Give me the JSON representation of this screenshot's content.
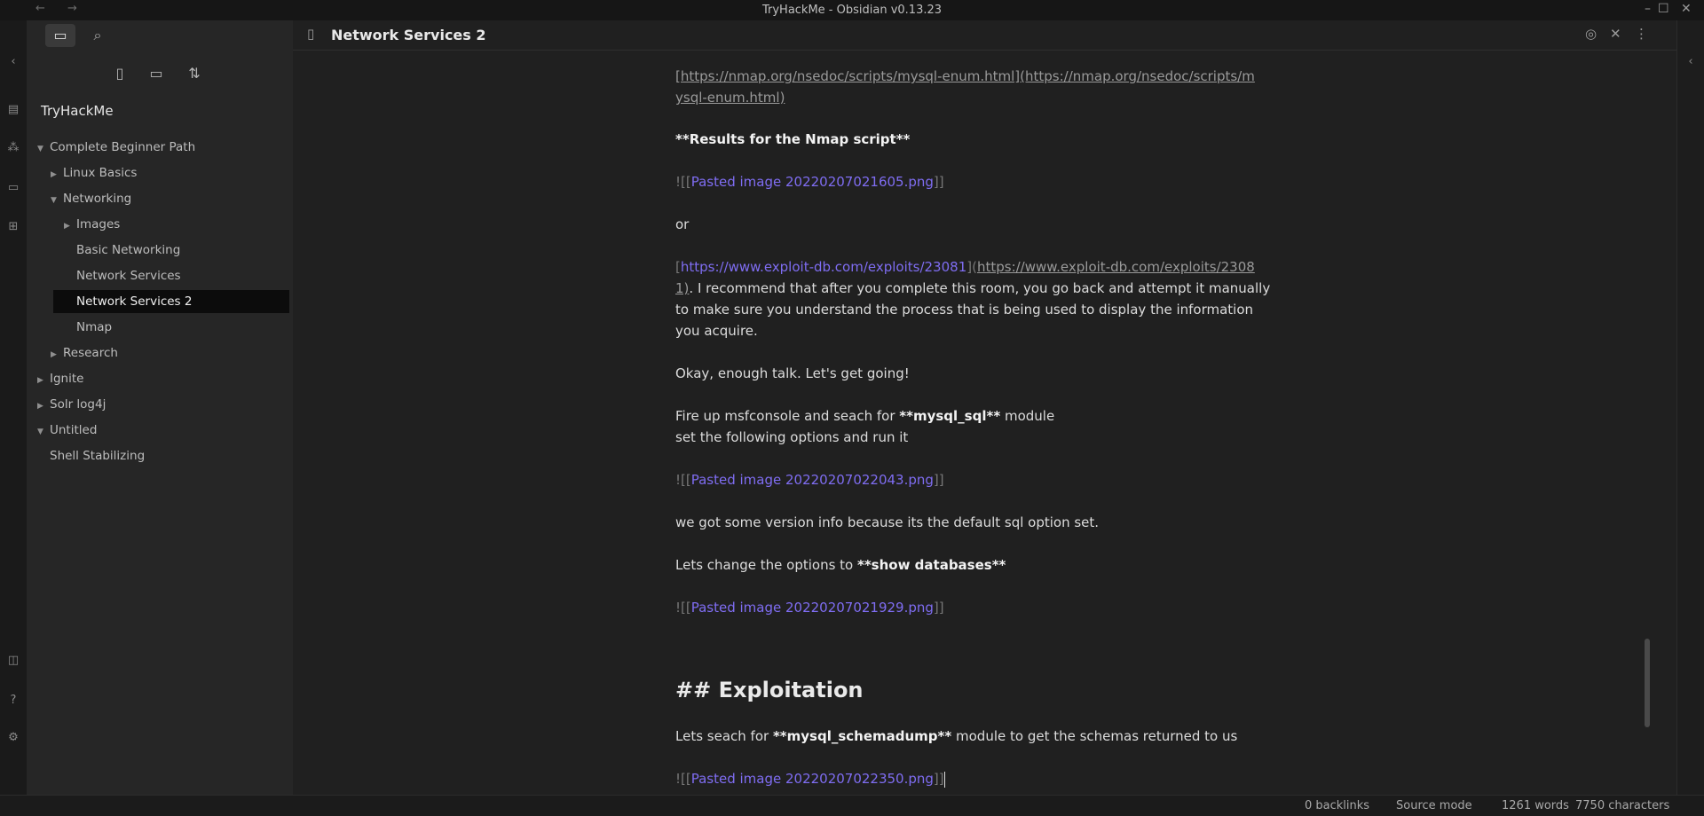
{
  "window": {
    "title": "TryHackMe - Obsidian v0.13.23",
    "nav_back": "←",
    "nav_forward": "→",
    "minimize": "–",
    "maximize": "☐",
    "close": "✕"
  },
  "ribbon": {
    "icons": [
      "collapse-sidebar-icon",
      "switcher-icon",
      "graph-icon",
      "card-icon",
      "plugin-icon",
      "vault-icon",
      "help-icon",
      "settings-icon"
    ]
  },
  "sidebar": {
    "tabs": [
      "folder-icon",
      "search-icon"
    ],
    "actions": [
      "new-note-icon",
      "new-folder-icon",
      "sort-icon"
    ],
    "vault_name": "TryHackMe",
    "tree": [
      {
        "label": "Complete Beginner Path",
        "caret": "▼"
      },
      {
        "label": "Linux Basics",
        "caret": "▶"
      },
      {
        "label": "Networking",
        "caret": "▼"
      },
      {
        "label": "Images",
        "caret": "▶"
      },
      {
        "label": "Basic Networking",
        "caret": ""
      },
      {
        "label": "Network Services",
        "caret": ""
      },
      {
        "label": "Network Services 2",
        "caret": ""
      },
      {
        "label": "Nmap",
        "caret": ""
      },
      {
        "label": "Research",
        "caret": "▶"
      },
      {
        "label": "Ignite",
        "caret": "▶"
      },
      {
        "label": "Solr log4j",
        "caret": "▶"
      },
      {
        "label": "Untitled",
        "caret": "▼"
      },
      {
        "label": "Shell Stabilizing",
        "caret": ""
      }
    ]
  },
  "header": {
    "title": "Network Services 2",
    "icons": [
      "reading-view-icon",
      "close-icon",
      "more-options-icon"
    ]
  },
  "editor": {
    "l_url1_a": "[https://nmap.org/nsedoc/scripts/mysql-enum.html](https://nmap.org/nsedoc/scripts/m",
    "l_url1_b": "ysql-enum.html)",
    "l_results": "**Results for the Nmap script**",
    "l_img1_pre": "![[",
    "l_img1": "Pasted image 20220207021605.png",
    "l_img_suf": "]]",
    "l_or": "or",
    "l_url2_a1": "[",
    "l_url2_link": "https://www.exploit-db.com/exploits/23081",
    "l_url2_mid": "](",
    "l_url2_url": "https://www.exploit-db.com/exploits/2308",
    "l_url2_b1": "1)",
    "l_url2_b2": ". I recommend that after you complete this room, you go back and attempt it manually",
    "l_url2_c": "to make sure you understand the process that is being used to display the information",
    "l_url2_d": "you acquire.",
    "l_okay": "Okay, enough talk. Let's get going!",
    "l_fire_1": "Fire up msfconsole and seach for ",
    "l_fire_b": "**mysql_sql**",
    "l_fire_2": " module",
    "l_set": "set the following options and run it",
    "l_img2": "Pasted image 20220207022043.png",
    "l_version": "we got some version info because its the default sql option set.",
    "l_lets_1": "Lets change the options to ",
    "l_lets_b": "**show databases**",
    "l_img3": "Pasted image 20220207021929.png",
    "l_heading": "## Exploitation",
    "l_schema_1": "Lets seach for ",
    "l_schema_b": "**mysql_schemadump**",
    "l_schema_2": " module to get the schemas returned to us",
    "l_img4": "Pasted image 20220207022350.png"
  },
  "status": {
    "backlinks": "0 backlinks",
    "mode": "Source mode",
    "words": "1261 words",
    "chars": "7750 characters"
  },
  "colors": {
    "accent": "#7f6df2",
    "background": "#202020",
    "sidebar": "#262626",
    "selected": "#0c0c0c"
  }
}
